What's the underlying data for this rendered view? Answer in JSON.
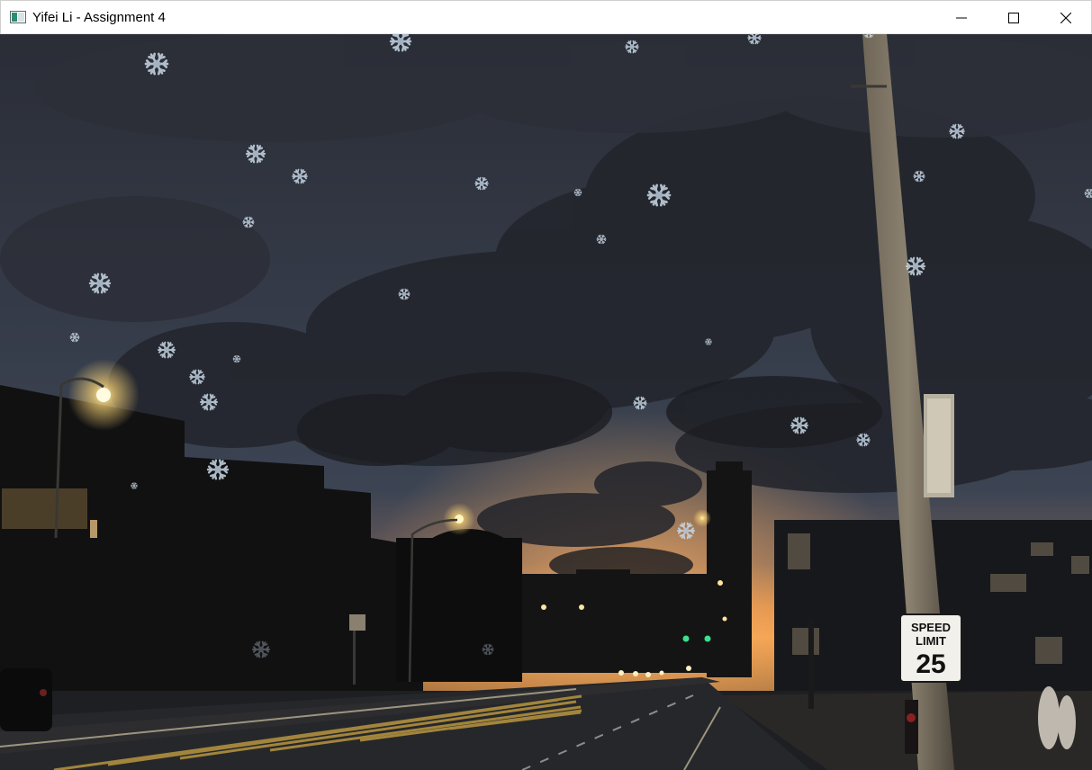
{
  "window": {
    "title": "Yifei Li - Assignment 4",
    "controls": {
      "minimize": "minimize",
      "maximize": "maximize",
      "close": "close"
    }
  },
  "scene": {
    "description_icon": "night-street-photo",
    "sign": {
      "line1": "SPEED",
      "line2": "LIMIT",
      "value": "25"
    },
    "snowflake_icon": "snowflake-icon"
  },
  "colors": {
    "sky_top": "#2b2f3a",
    "sky_mid": "#3a4252",
    "horizon_orange": "#e58a3a",
    "snowflake": "#c9d8e6",
    "titlebar_bg": "#ffffff"
  }
}
